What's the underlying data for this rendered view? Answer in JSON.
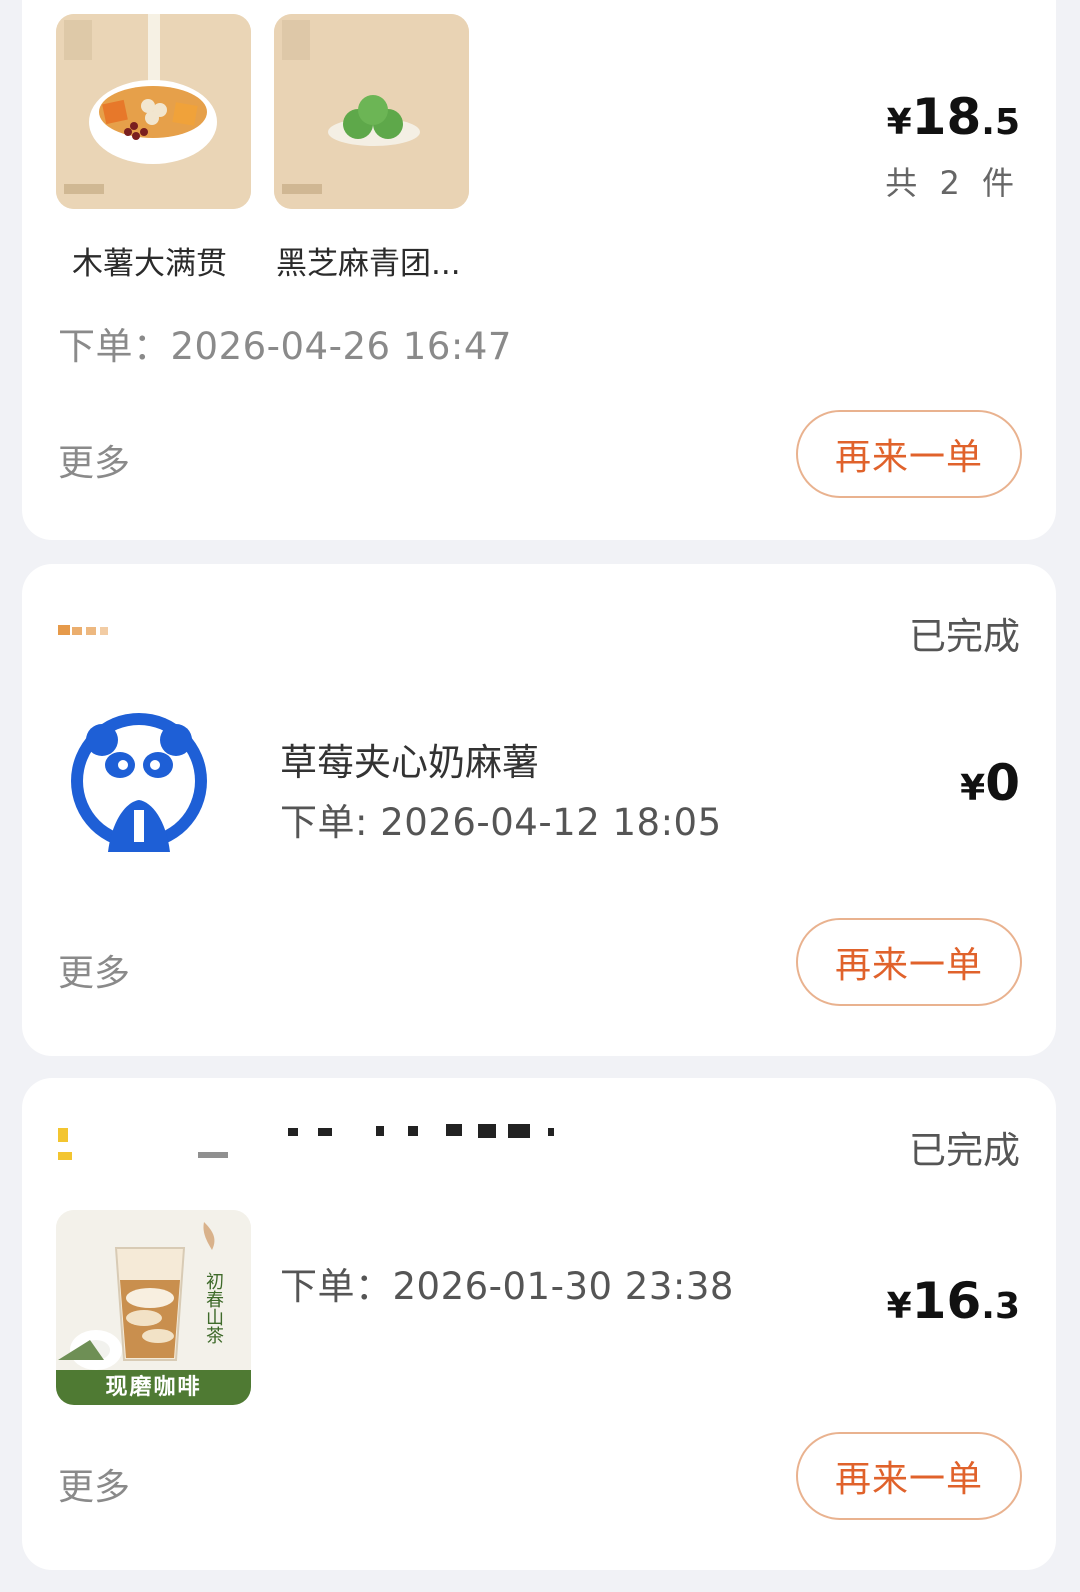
{
  "orders": [
    {
      "items": [
        {
          "name": "木薯大满贯",
          "image": "taro-dessert-bowl"
        },
        {
          "name": "黑芝麻青团...",
          "image": "green-rice-balls"
        }
      ],
      "price_symbol": "¥",
      "price_int": "18",
      "price_dec": ".5",
      "count_text": "共 2 件",
      "order_time": "下单：2026-04-26 16:47",
      "more_label": "更多",
      "reorder_label": "再来一单"
    },
    {
      "status": "已完成",
      "product_name": "草莓夹心奶麻薯",
      "order_time": "下单: 2026-04-12 18:05",
      "price_symbol": "¥",
      "price_int": "0",
      "logo": "panda-logo",
      "more_label": "更多",
      "reorder_label": "再来一单"
    },
    {
      "status": "已完成",
      "order_time": "下单：2026-01-30 23:38",
      "price_symbol": "¥",
      "price_int": "16",
      "price_dec": ".3",
      "image_caption_vertical": "初春山茶",
      "image_banner": "现磨咖啡",
      "more_label": "更多",
      "reorder_label": "再来一单"
    }
  ],
  "colors": {
    "background": "#f1f2f6",
    "accent": "#e0622b",
    "button_border": "#e9b28f",
    "panda_blue": "#1e5fd6"
  }
}
